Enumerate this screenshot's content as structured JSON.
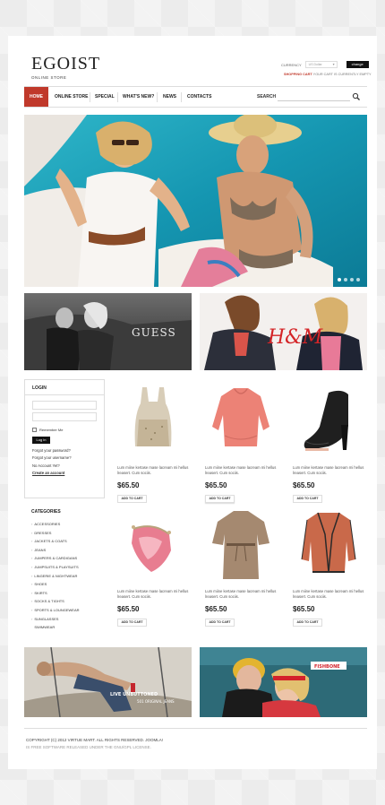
{
  "brand": {
    "name": "EGOIST",
    "tagline": "ONLINE STORE"
  },
  "currency": {
    "label": "CURRENCY",
    "selected": "US Dollar",
    "change_label": "change"
  },
  "cart": {
    "title": "SHOPPING CART",
    "status": "YOUR CART IS CURRENTLY EMPTY"
  },
  "nav": {
    "items": [
      {
        "label": "HOME",
        "active": true
      },
      {
        "label": "ONLINE STORE"
      },
      {
        "label": "SPECIAL"
      },
      {
        "label": "WHAT'S NEW?"
      },
      {
        "label": "NEWS"
      },
      {
        "label": "CONTACTS"
      }
    ],
    "search_label": "SEARCH"
  },
  "hero": {
    "slides": 4,
    "active_slide": 1
  },
  "banners": {
    "guess_text": "GUESS",
    "hm_text": "H&M",
    "levis_text": "LIVE UNBUTTONED",
    "levis_sub": "501 ORIGINAL JEANS",
    "fashion_text": "FISHBONE"
  },
  "login": {
    "title": "LOGIN",
    "remember_label": "Remember Me",
    "button_label": "Log in",
    "forgot_password": "Forgot your password?",
    "forgot_username": "Forgot your username?",
    "no_account": "No Account Yet?",
    "create_account": "Create an account"
  },
  "categories": {
    "title": "CATEGORIES",
    "items": [
      "ACCESSORIES",
      "DRESSES",
      "JACKETS & COATS",
      "JEANS",
      "JUMPERS & CARDIGANS",
      "JUMPSUITS & PLAYSUITS",
      "LINGERIE & NIGHTWEAR",
      "SHOES",
      "SKIRTS",
      "SOCKS & TIGHTS",
      "SPORTS & LOUNGEWEAR",
      "SUNGLASSES",
      "SWIMWEAR"
    ]
  },
  "products": [
    {
      "desc": "Lum miine kertase mase lacream mi hellus lreasert. Cum sociis.",
      "price": "$65.50",
      "button": "ADD TO CART"
    },
    {
      "desc": "Lum miine kertase mase lacream mi hellus lreasert. Cum sociis.",
      "price": "$65.50",
      "button": "ADD TO CART"
    },
    {
      "desc": "Lum miine kertase mase lacream mi hellus lreasert. Cum sociis.",
      "price": "$65.50",
      "button": "ADD TO CART"
    },
    {
      "desc": "Lum miine kertase mase lacream mi hellus lreasert. Cum sociis.",
      "price": "$65.50",
      "button": "ADD TO CART"
    },
    {
      "desc": "Lum miine kertase mase lacream mi hellus lreasert. Cum sociis.",
      "price": "$65.50",
      "button": "ADD TO CART"
    },
    {
      "desc": "Lum miine kertase mase lacream mi hellus lreasert. Cum sociis.",
      "price": "$65.50",
      "button": "ADD TO CART"
    }
  ],
  "footer": {
    "copyright": "COPYRIGHT (C) 2012 VIRTUE MART. ALL RIGHTS RESERVED. JOOMLA!",
    "license": "IS FREE SOFTWARE RELEASED UNDER THE GNU/GPL LICENSE."
  },
  "colors": {
    "accent": "#c0392b",
    "dark": "#111111",
    "border": "#dddddd"
  }
}
